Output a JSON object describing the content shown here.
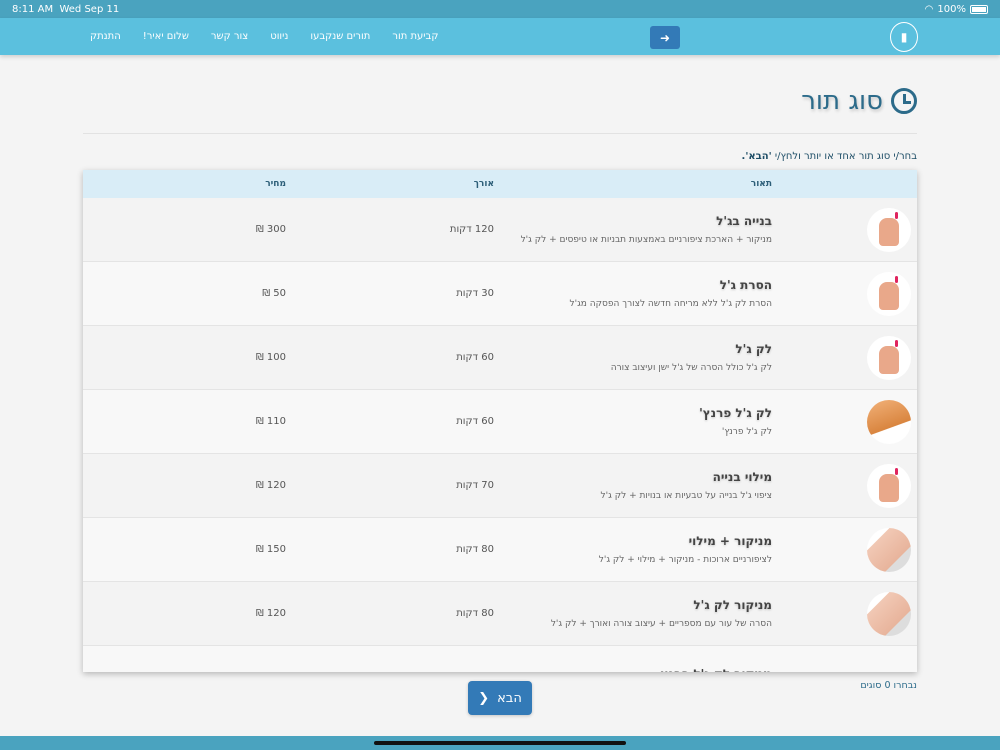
{
  "status_bar": {
    "time": "8:11 AM",
    "date": "Wed Sep 11",
    "battery": "100%"
  },
  "nav": {
    "links": [
      "קביעת תור",
      "תורים שנקבעו",
      "ניווט",
      "צור קשר",
      "שלום יאיר!",
      "התנתק"
    ],
    "forward_icon": "➜",
    "logo_icon": "nail-polish-logo"
  },
  "page": {
    "title": "סוג תור",
    "instruction": "בחר/י סוג תור אחד או יותר ולחץ/י ",
    "instruction_bold": "'הבא'."
  },
  "table": {
    "headers": {
      "description": "תאור",
      "duration": "אורך",
      "price": "מחיר"
    },
    "rows": [
      {
        "title": "בנייה בג'ל",
        "desc": "מניקור + הארכת ציפורניים באמצעות תבניות או טיפסים + לק ג'ל",
        "duration": "120 דקות",
        "price": "300 ₪",
        "image": "hand"
      },
      {
        "title": "הסרת ג'ל",
        "desc": "הסרת לק ג'ל ללא מריחה חדשה לצורך הפסקה מג'ל",
        "duration": "30 דקות",
        "price": "50 ₪",
        "image": "hand"
      },
      {
        "title": "לק ג'ל",
        "desc": "לק ג'ל כולל הסרה של ג'ל ישן ועיצוב צורה",
        "duration": "60 דקות",
        "price": "100 ₪",
        "image": "hand"
      },
      {
        "title": "לק ג'ל פרנץ'",
        "desc": "לק ג'ל פרנץ'",
        "duration": "60 דקות",
        "price": "110 ₪",
        "image": "french"
      },
      {
        "title": "מילוי בנייה",
        "desc": "ציפוי ג'ל בנייה על טבעיות או בנויות + לק ג'ל",
        "duration": "70 דקות",
        "price": "120 ₪",
        "image": "hand"
      },
      {
        "title": "מניקור + מילוי",
        "desc": "לציפורניים ארוכות - מניקור + מילוי + לק ג'ל",
        "duration": "80 דקות",
        "price": "150 ₪",
        "image": "mani"
      },
      {
        "title": "מניקור לק ג'ל",
        "desc": "הסרה של עור עם מספריים + עיצוב צורה ואורך + לק ג'ל",
        "duration": "80 דקות",
        "price": "120 ₪",
        "image": "mani"
      },
      {
        "title": "מניקור לק ג'ל פרנץ",
        "desc": "",
        "duration": "",
        "price": "",
        "image": "none"
      }
    ]
  },
  "footer": {
    "selected_count": "נבחרו 0 סוגים",
    "next_label": "הבא",
    "next_icon": "❮"
  }
}
